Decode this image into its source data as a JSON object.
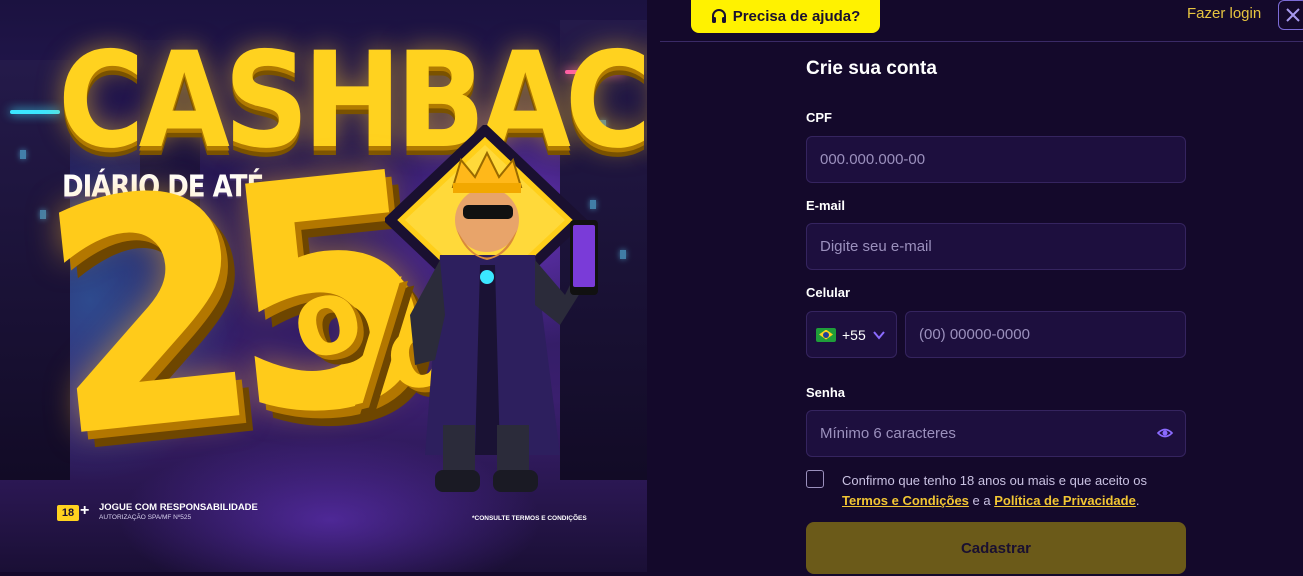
{
  "banner": {
    "headline": "CASHBACK",
    "subheadline": "DIÁRIO DE ATÉ",
    "percent_value": "25",
    "percent_sign": "%",
    "age_badge": "18",
    "age_plus": "+",
    "responsibility": "JOGUE COM RESPONSABILIDADE",
    "authorization": "AUTORIZAÇÃO SPA/MF Nº525",
    "disclaimer": "*CONSULTE TERMOS E CONDIÇÕES"
  },
  "header": {
    "help_label": "Precisa de ajuda?",
    "help_icon": "headset-icon",
    "login_label": "Fazer login",
    "close_icon": "close-icon"
  },
  "form": {
    "title": "Crie sua conta",
    "cpf": {
      "label": "CPF",
      "placeholder": "000.000.000-00",
      "value": ""
    },
    "email": {
      "label": "E-mail",
      "placeholder": "Digite seu e-mail",
      "value": ""
    },
    "phone": {
      "label": "Celular",
      "country_code": "+55",
      "country_flag": "brazil-flag-icon",
      "placeholder": "(00) 00000-0000",
      "value": ""
    },
    "password": {
      "label": "Senha",
      "placeholder": "Mínimo 6 caracteres",
      "value": "",
      "toggle_icon": "eye-icon"
    },
    "consent": {
      "checked": false,
      "text_before": "Confirmo que tenho 18 anos ou mais e que aceito os ",
      "terms_link": "Termos e Condições",
      "text_middle": " e a ",
      "privacy_link": "Política de Privacidade",
      "text_after": "."
    },
    "submit_label": "Cadastrar"
  },
  "colors": {
    "background": "#14092b",
    "accent_yellow": "#fff200",
    "link_gold": "#f2c633",
    "field_bg": "#1d0f3e",
    "submit_bg": "#6b5a19",
    "eye_icon": "#8b6bff"
  }
}
